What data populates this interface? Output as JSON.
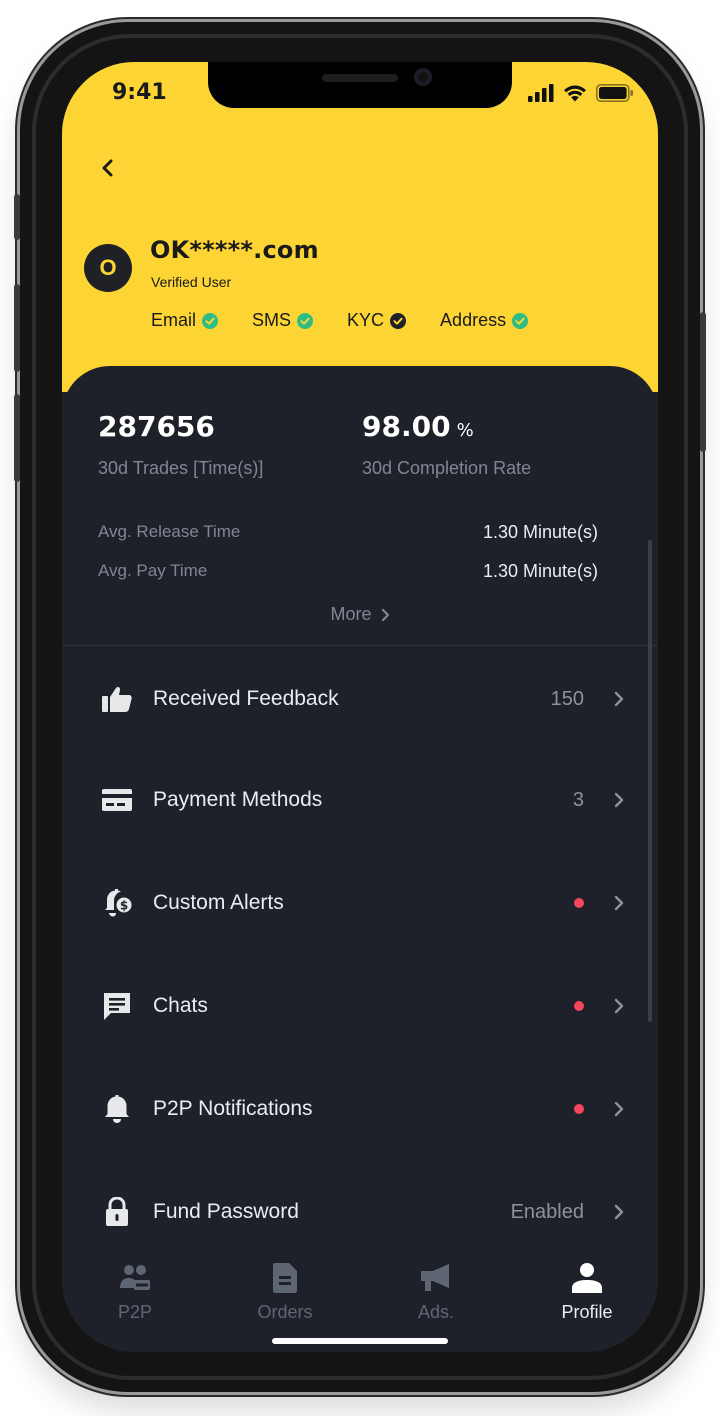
{
  "status_bar": {
    "time": "9:41"
  },
  "profile": {
    "avatar_letter": "O",
    "username": "OK*****.com",
    "role": "Verified User",
    "verifications": [
      {
        "label": "Email",
        "check_color": "#2ebd85"
      },
      {
        "label": "SMS",
        "check_color": "#2ebd85"
      },
      {
        "label": "KYC",
        "check_color": "#1e2026"
      },
      {
        "label": "Address",
        "check_color": "#2ebd85"
      }
    ]
  },
  "stats": {
    "trades_value": "287656",
    "trades_label": "30d Trades [Time(s)]",
    "completion_value": "98.00",
    "completion_unit": "%",
    "completion_label": "30d Completion Rate",
    "release_label": "Avg. Release Time",
    "release_value": "1.30  Minute(s)",
    "pay_label": "Avg. Pay Time",
    "pay_value": "1.30  Minute(s)",
    "more_label": "More"
  },
  "menu": [
    {
      "label": "Received Feedback",
      "value": "150",
      "icon": "thumbs-up-icon"
    },
    {
      "label": "Payment Methods",
      "value": "3",
      "icon": "card-icon"
    },
    {
      "label": "Custom Alerts",
      "value": "",
      "icon": "alert-bell-dollar-icon"
    },
    {
      "label": "Chats",
      "value": "",
      "icon": "chat-icon"
    },
    {
      "label": "P2P Notifications",
      "value": "",
      "icon": "bell-icon"
    },
    {
      "label": "Fund Password",
      "value": "Enabled",
      "icon": "lock-icon"
    }
  ],
  "tabs": [
    {
      "label": "P2P",
      "icon": "users-icon",
      "active": false
    },
    {
      "label": "Orders",
      "icon": "document-icon",
      "active": false
    },
    {
      "label": "Ads.",
      "icon": "megaphone-icon",
      "active": false
    },
    {
      "label": "Profile",
      "icon": "person-icon",
      "active": true
    }
  ],
  "colors": {
    "brand_yellow": "#fcd535",
    "background": "#1e2129",
    "alert_dot": "#f6465d",
    "verified_green": "#2ebd85",
    "muted_text": "#7f8694"
  }
}
